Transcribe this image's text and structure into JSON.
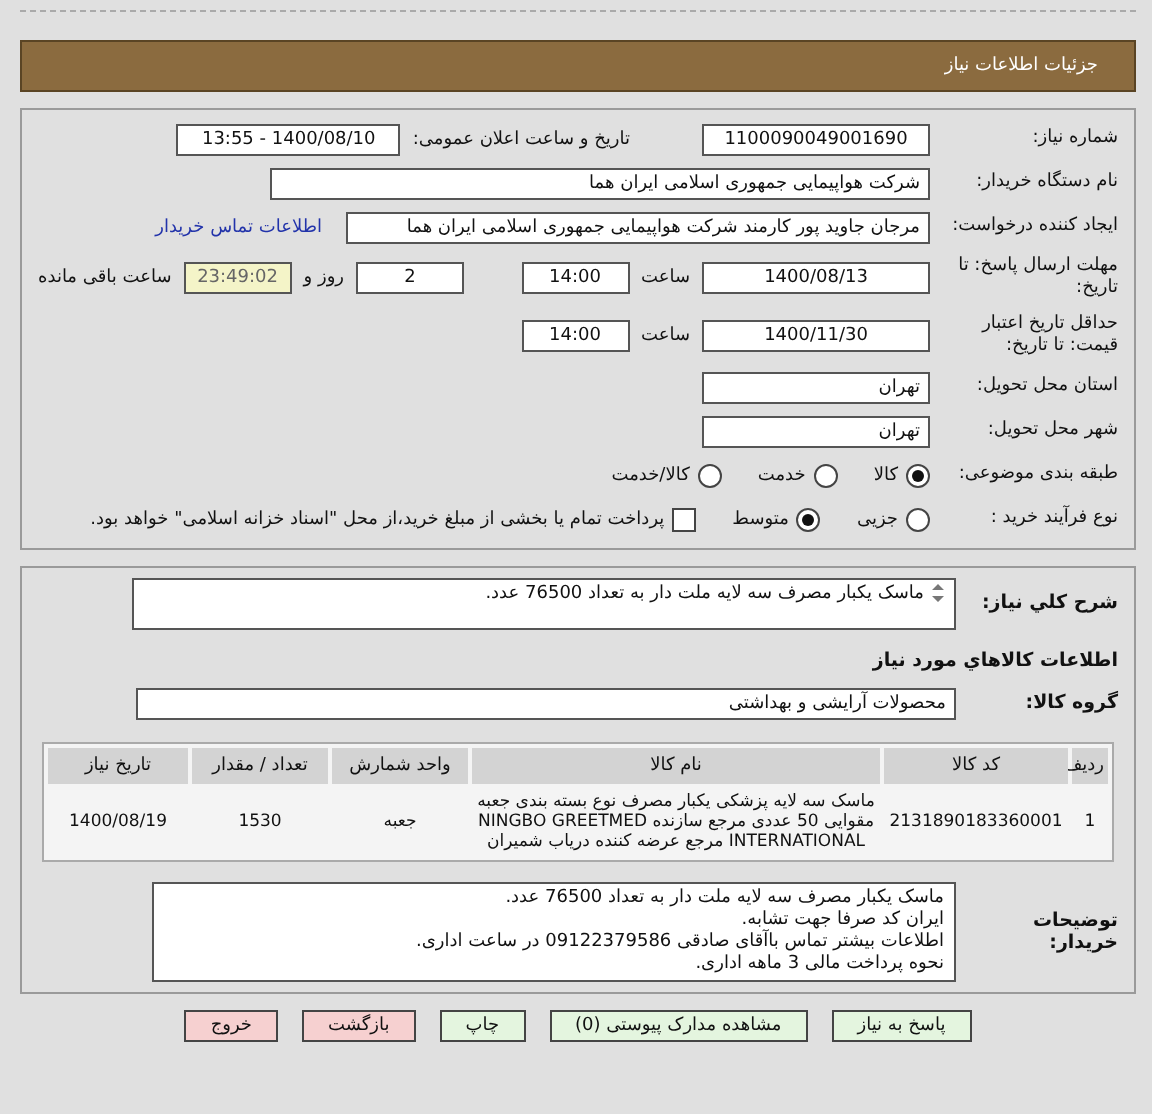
{
  "header": {
    "title": "جزئیات اطلاعات نیاز"
  },
  "need_number": {
    "label": "شماره نیاز:",
    "value": "1100090049001690"
  },
  "announce": {
    "label": "تاریخ و ساعت اعلان عمومی:",
    "value": "1400/08/10 - 13:55"
  },
  "buyer": {
    "label": "نام دستگاه خریدار:",
    "value": "شرکت هواپیمایی جمهوری اسلامی ایران هما"
  },
  "creator": {
    "label": "ایجاد کننده درخواست:",
    "value": "مرجان جاوید پور کارمند شرکت هواپیمایی جمهوری اسلامی ایران هما",
    "link": "اطلاعات تماس خریدار"
  },
  "deadline": {
    "label": "مهلت ارسال پاسخ: تا تاریخ:",
    "date": "1400/08/13",
    "time_label": "ساعت",
    "time": "14:00",
    "days": "2",
    "days_label": "روز و",
    "remaining": "23:49:02",
    "remaining_label": "ساعت باقی مانده"
  },
  "validity": {
    "label": "حداقل تاریخ اعتبار قیمت: تا تاریخ:",
    "date": "1400/11/30",
    "time_label": "ساعت",
    "time": "14:00"
  },
  "province": {
    "label": "استان محل تحویل:",
    "value": "تهران"
  },
  "city": {
    "label": "شهر محل تحویل:",
    "value": "تهران"
  },
  "category": {
    "label": "طبقه بندی موضوعی:",
    "options": [
      {
        "label": "کالا",
        "selected": true
      },
      {
        "label": "خدمت",
        "selected": false
      },
      {
        "label": "کالا/خدمت",
        "selected": false
      }
    ]
  },
  "process": {
    "label": "نوع فرآیند خرید :",
    "options": [
      {
        "label": "جزیی",
        "selected": false
      },
      {
        "label": "متوسط",
        "selected": true
      }
    ],
    "treasury": {
      "label": "پرداخت تمام یا بخشی از مبلغ خرید،از محل \"اسناد خزانه اسلامی\" خواهد بود.",
      "checked": false
    }
  },
  "description": {
    "label": "شرح کلي نياز:",
    "value": "ماسک یکبار مصرف سه لایه ملت دار به تعداد 76500 عدد."
  },
  "goods_heading": "اطلاعات کالاهاي مورد نياز",
  "goods_group": {
    "label": "گروه کالا:",
    "value": "محصولات آرایشی و بهداشتی"
  },
  "table": {
    "columns": [
      "ردیف",
      "کد کالا",
      "نام کالا",
      "واحد شمارش",
      "تعداد / مقدار",
      "تاریخ نیاز"
    ],
    "rows": [
      [
        "1",
        "2131890183360001",
        "ماسک سه لایه پزشکی یکبار مصرف نوع بسته بندی جعبه مقوایی 50 عددی مرجع سازنده NINGBO GREETMED INTERNATIONAL مرجع عرضه کننده دریاب شمیران",
        "جعبه",
        "1530",
        "1400/08/19"
      ]
    ]
  },
  "notes": {
    "label": "توضیحات خریدار:",
    "lines": [
      "ماسک یکبار مصرف سه لایه ملت دار به تعداد 76500 عدد.",
      "ایران کد صرفا جهت تشابه.",
      "اطلاعات بیشتر تماس باآقای صادقی 09122379586 در ساعت اداری.",
      "نحوه پرداخت مالی 3 ماهه اداری."
    ]
  },
  "buttons": [
    {
      "label": "پاسخ به نیاز",
      "kind": "action"
    },
    {
      "label": "مشاهده مدارک پیوستی (0)",
      "kind": "action"
    },
    {
      "label": "چاپ",
      "kind": "action"
    },
    {
      "label": "بازگشت",
      "kind": "exit"
    },
    {
      "label": "خروج",
      "kind": "exit"
    }
  ]
}
